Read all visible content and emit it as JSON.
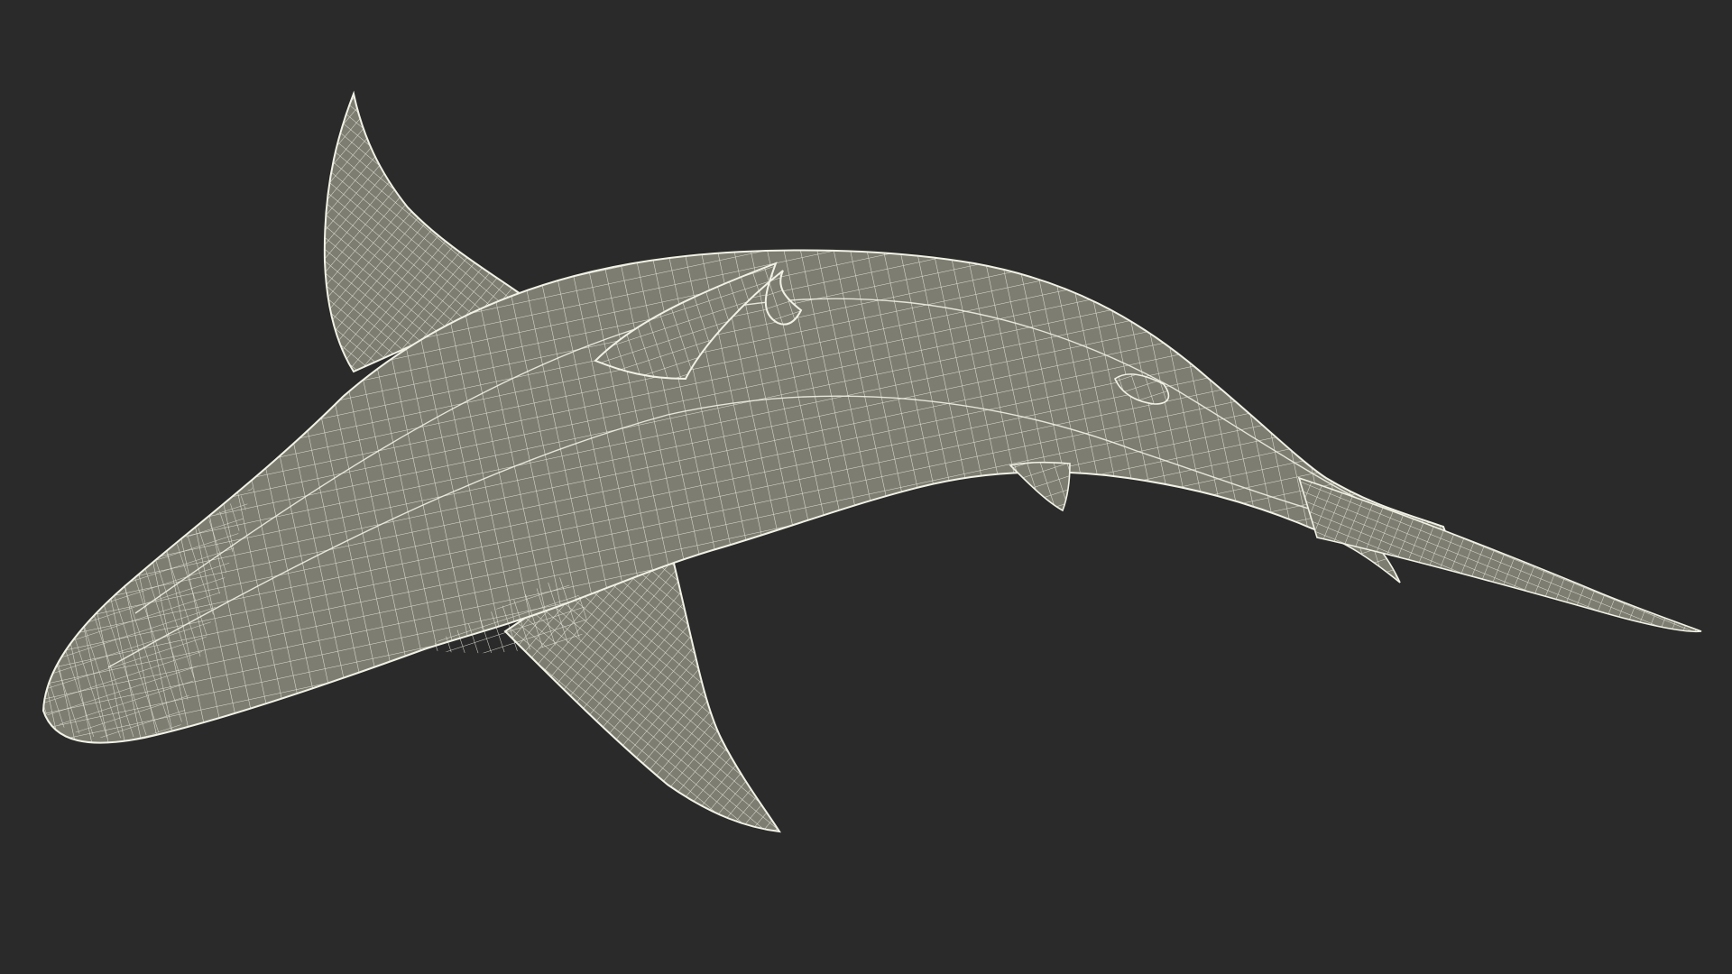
{
  "scene": {
    "subject": "shark-wireframe-model",
    "background_color": "#2a2a2a",
    "mesh_fill_color": "#7e7d72",
    "mesh_line_color": "#f1f1e6",
    "mesh_line_opacity": 0.85
  }
}
